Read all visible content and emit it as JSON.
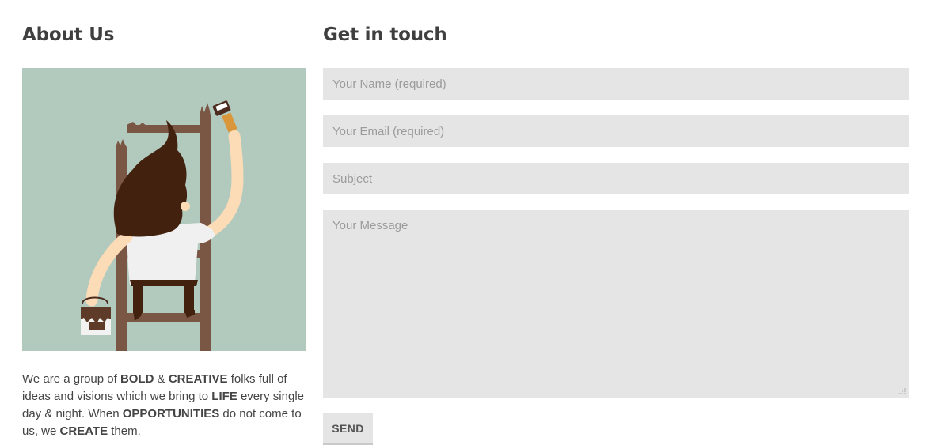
{
  "about": {
    "heading": "About Us",
    "illustration_icon": "painter-on-ladder-illustration",
    "text": [
      {
        "t": "We are a group of ",
        "b": false
      },
      {
        "t": "BOLD",
        "b": true
      },
      {
        "t": " & ",
        "b": false
      },
      {
        "t": "CREATIVE",
        "b": true
      },
      {
        "t": " folks full of ideas and visions which we bring to ",
        "b": false
      },
      {
        "t": "LIFE",
        "b": true
      },
      {
        "t": " every single day & night. When ",
        "b": false
      },
      {
        "t": "OPPORTUNITIES",
        "b": true
      },
      {
        "t": " do not come to us, we ",
        "b": false
      },
      {
        "t": "CREATE",
        "b": true
      },
      {
        "t": " them.",
        "b": false
      }
    ]
  },
  "contact": {
    "heading": "Get in touch",
    "name_placeholder": "Your Name (required)",
    "email_placeholder": "Your Email (required)",
    "subject_placeholder": "Subject",
    "message_placeholder": "Your Message",
    "send_label": "SEND"
  },
  "colors": {
    "illustration_bg": "#b2c9bd",
    "ladder": "#7a5644",
    "hair": "#42210f",
    "skin": "#fbdcb6",
    "shirt": "#f0f0f0",
    "field_bg": "#e5e5e5"
  }
}
